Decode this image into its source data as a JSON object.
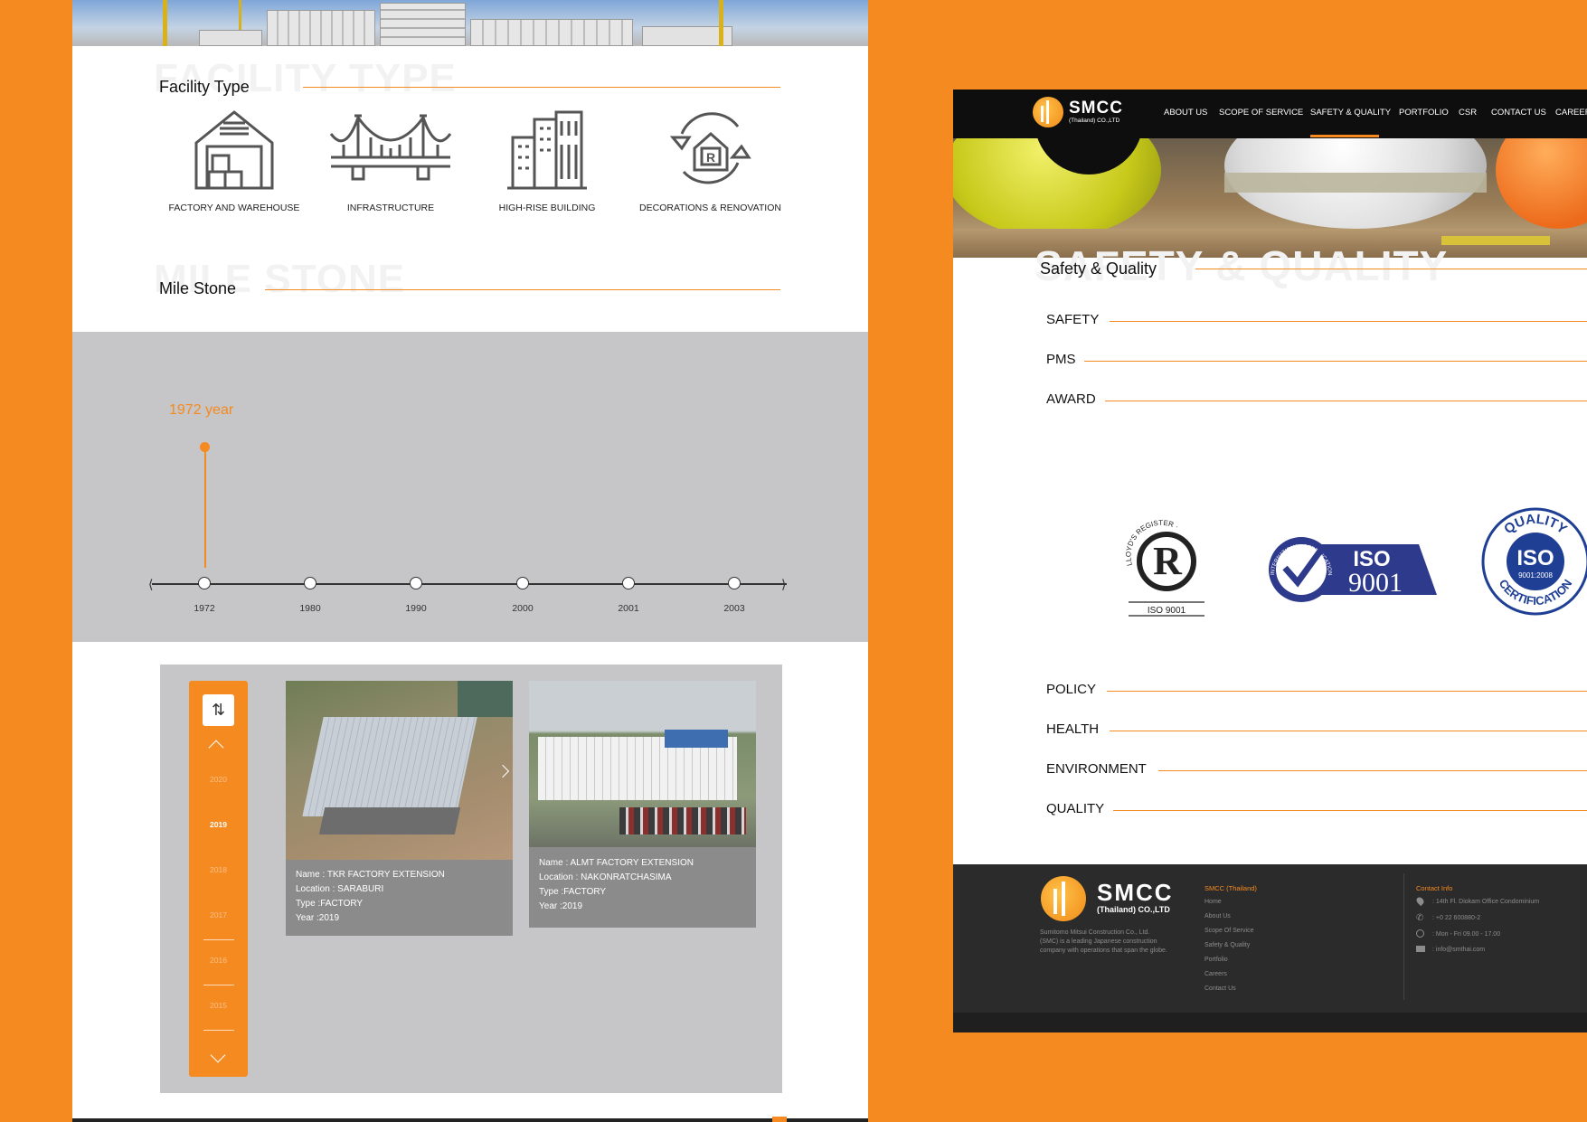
{
  "left_page": {
    "facility": {
      "ghost_title": "FACILITY TYPE",
      "title": "Facility Type",
      "items": [
        {
          "label": "FACTORY AND WAREHOUSE",
          "icon": "factory-warehouse-icon"
        },
        {
          "label": "INFRASTRUCTURE",
          "icon": "bridge-icon"
        },
        {
          "label": "HIGH-RISE BUILDING",
          "icon": "highrise-building-icon"
        },
        {
          "label": "DECORATIONS & RENOVATION",
          "icon": "renovation-house-icon"
        }
      ]
    },
    "milestone": {
      "ghost_title": "MILE STONE",
      "title": "Mile Stone",
      "active_label": "1972 year",
      "years": [
        "1972",
        "1980",
        "1990",
        "2000",
        "2001",
        "2003"
      ]
    },
    "year_picker": {
      "toggle_symbol": "⇅",
      "years": [
        "2020",
        "2019",
        "2018",
        "2017",
        "2016",
        "2015"
      ],
      "selected": "2019"
    },
    "projects": [
      {
        "name": "Name : TKR FACTORY EXTENSION",
        "location": "Location : SARABURI",
        "type": "Type :FACTORY",
        "year": "Year :2019"
      },
      {
        "name": "Name : ALMT FACTORY EXTENSION",
        "location": "Location : NAKONRATCHASIMA",
        "type": "Type :FACTORY",
        "year": "Year :2019"
      }
    ]
  },
  "right_page": {
    "logo": {
      "brand": "SMCC",
      "sub": "(Thailand) CO.,LTD"
    },
    "nav": [
      {
        "label": "ABOUT US"
      },
      {
        "label": "SCOPE OF SERVICE"
      },
      {
        "label": "SAFETY & QUALITY",
        "active": true
      },
      {
        "label": "PORTFOLIO"
      },
      {
        "label": "CSR"
      },
      {
        "label": "CONTACT US"
      },
      {
        "label": "CAREER"
      }
    ],
    "section": {
      "ghost_title": "SAFETY & QUALITY",
      "title": "Safety & Quality",
      "items_top": [
        "SAFETY",
        "PMS",
        "AWARD"
      ],
      "items_bottom": [
        "POLICY",
        "HEALTH",
        "ENVIRONMENT",
        "QUALITY"
      ]
    },
    "certifications": {
      "lrqa": {
        "ring_text": "LLOYD'S REGISTER · LRQA",
        "caption": "ISO 9001"
      },
      "iso_badge": {
        "ring_text": "INTERNATIONAL CERTIFICATION",
        "iso": "ISO",
        "number": "9001"
      },
      "quality_seal": {
        "top": "QUALITY",
        "iso": "ISO",
        "number": "9001:2008",
        "bottom": "CERTIFICATION"
      }
    },
    "footer": {
      "logo_brand": "SMCC",
      "logo_sub": "(Thailand) CO.,LTD",
      "description": [
        "Sumitomo Mitsui Construction Co., Ltd.",
        "(SMC) is a leading Japanese construction",
        "company with operations that span the globe."
      ],
      "links_title": "SMCC (Thailand)",
      "links": [
        "Home",
        "About Us",
        "Scope Of Service",
        "Safety & Quality",
        "Portfolio",
        "Careers",
        "Contact Us"
      ],
      "contact_title": "Contact Info",
      "contact": [
        {
          "icon": "location-pin-icon",
          "text": ": 14th Fl. Diokam Office Condominium"
        },
        {
          "icon": "phone-icon",
          "text": ": +0 22 600880-2"
        },
        {
          "icon": "clock-icon",
          "text": ": Mon - Fri 09.00 - 17.00"
        },
        {
          "icon": "mail-icon",
          "text": ": info@smthai.com"
        }
      ]
    }
  },
  "colors": {
    "accent": "#f58a20",
    "background": "#f58a20",
    "band_gray": "#c6c5c7",
    "card_gray": "#8b8b8b",
    "nav_black": "#0e0e0e",
    "footer": "#2b2b2b",
    "iso_blue": "#2e3a8c"
  }
}
